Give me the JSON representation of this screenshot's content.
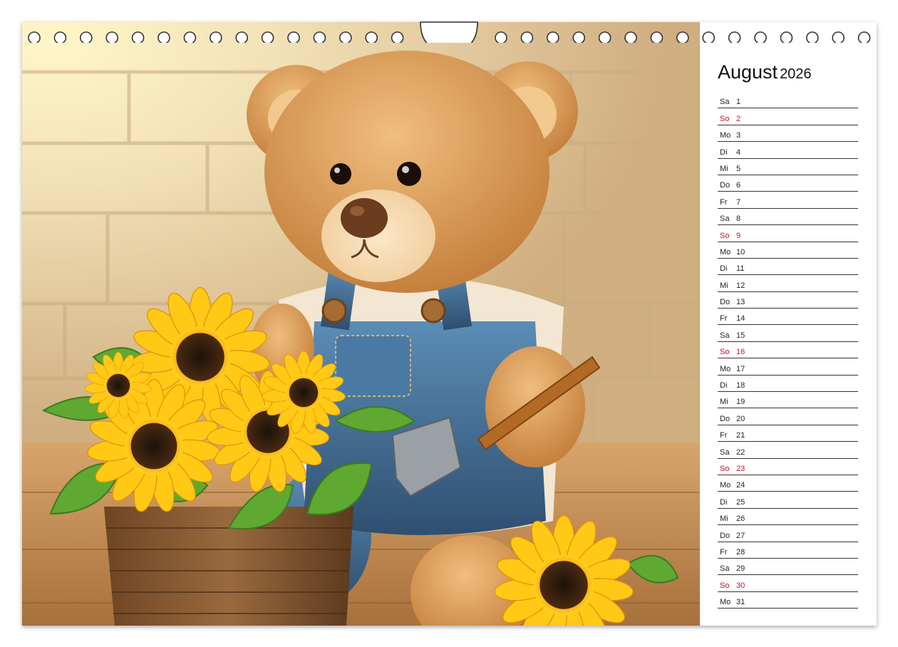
{
  "calendar": {
    "month": "August",
    "year": "2026",
    "days": [
      {
        "wd": "Sa",
        "d": "1",
        "sun": false
      },
      {
        "wd": "So",
        "d": "2",
        "sun": true
      },
      {
        "wd": "Mo",
        "d": "3",
        "sun": false
      },
      {
        "wd": "Di",
        "d": "4",
        "sun": false
      },
      {
        "wd": "Mi",
        "d": "5",
        "sun": false
      },
      {
        "wd": "Do",
        "d": "6",
        "sun": false
      },
      {
        "wd": "Fr",
        "d": "7",
        "sun": false
      },
      {
        "wd": "Sa",
        "d": "8",
        "sun": false
      },
      {
        "wd": "So",
        "d": "9",
        "sun": true
      },
      {
        "wd": "Mo",
        "d": "10",
        "sun": false
      },
      {
        "wd": "Di",
        "d": "11",
        "sun": false
      },
      {
        "wd": "Mi",
        "d": "12",
        "sun": false
      },
      {
        "wd": "Do",
        "d": "13",
        "sun": false
      },
      {
        "wd": "Fr",
        "d": "14",
        "sun": false
      },
      {
        "wd": "Sa",
        "d": "15",
        "sun": false
      },
      {
        "wd": "So",
        "d": "16",
        "sun": true
      },
      {
        "wd": "Mo",
        "d": "17",
        "sun": false
      },
      {
        "wd": "Di",
        "d": "18",
        "sun": false
      },
      {
        "wd": "Mi",
        "d": "19",
        "sun": false
      },
      {
        "wd": "Do",
        "d": "20",
        "sun": false
      },
      {
        "wd": "Fr",
        "d": "21",
        "sun": false
      },
      {
        "wd": "Sa",
        "d": "22",
        "sun": false
      },
      {
        "wd": "So",
        "d": "23",
        "sun": true
      },
      {
        "wd": "Mo",
        "d": "24",
        "sun": false
      },
      {
        "wd": "Di",
        "d": "25",
        "sun": false
      },
      {
        "wd": "Mi",
        "d": "26",
        "sun": false
      },
      {
        "wd": "Do",
        "d": "27",
        "sun": false
      },
      {
        "wd": "Fr",
        "d": "28",
        "sun": false
      },
      {
        "wd": "Sa",
        "d": "29",
        "sun": false
      },
      {
        "wd": "So",
        "d": "30",
        "sun": true
      },
      {
        "wd": "Mo",
        "d": "31",
        "sun": false
      }
    ]
  },
  "colors": {
    "sunday": "#c8102e",
    "text": "#222222",
    "fur": "#d9974f",
    "overalls": "#4f7ea6",
    "sunflower": "#f7b614",
    "wall": "#efd9b0"
  }
}
